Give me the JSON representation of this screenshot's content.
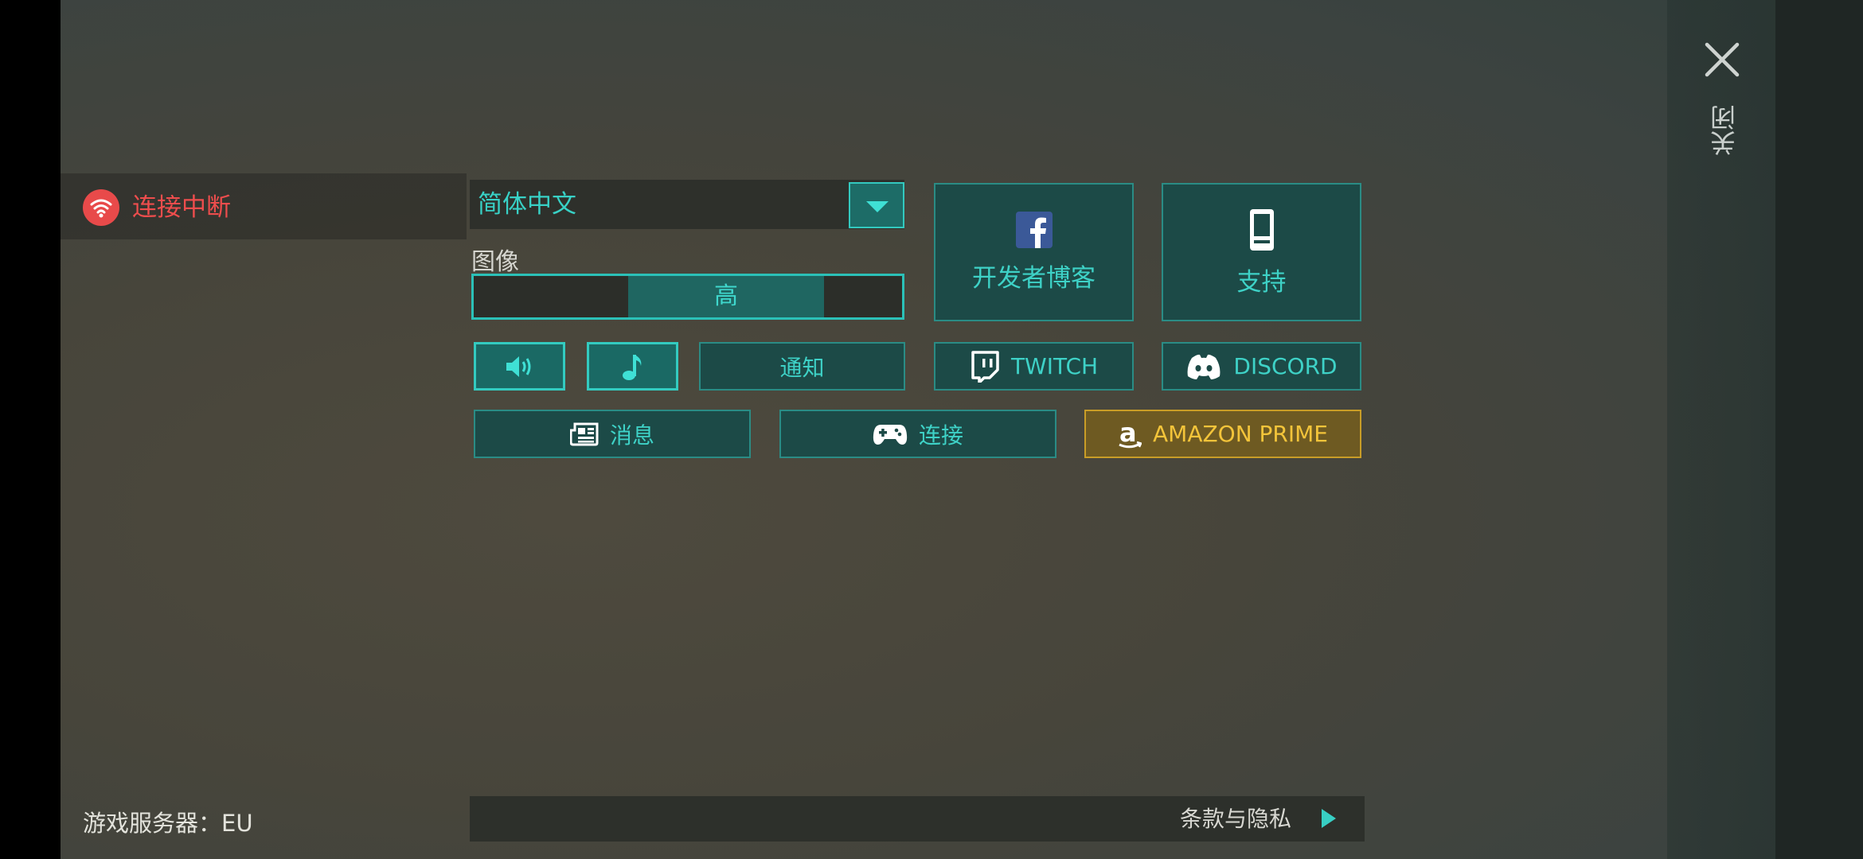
{
  "connection": {
    "status_label": "连接中断",
    "icon": "wifi-icon",
    "color": "#e84a4a"
  },
  "settings": {
    "language": {
      "selected": "简体中文",
      "icon": "chevron-down-icon"
    },
    "graphics": {
      "label": "图像",
      "selected": "高"
    },
    "notifications_label": "通知"
  },
  "links": {
    "blog": {
      "label": "开发者博客",
      "icon": "facebook-icon"
    },
    "support": {
      "label": "支持",
      "icon": "phone-icon"
    },
    "twitch": {
      "label": "TWITCH",
      "icon": "twitch-icon"
    },
    "discord": {
      "label": "DISCORD",
      "icon": "discord-icon"
    },
    "news": {
      "label": "消息",
      "icon": "newspaper-icon"
    },
    "connect": {
      "label": "连接",
      "icon": "gamepad-icon"
    },
    "amazon": {
      "label": "AMAZON PRIME",
      "icon": "amazon-icon"
    }
  },
  "toggles": {
    "sound_icon": "speaker-icon",
    "music_icon": "music-note-icon"
  },
  "close": {
    "label": "关闭",
    "icon": "close-icon"
  },
  "footer": {
    "server_label": "游戏服务器：",
    "server_value": "EU",
    "terms_label": "条款与隐私"
  },
  "colors": {
    "accent": "#38d1c6",
    "gold": "#f3c43a",
    "danger": "#ee4d4d"
  }
}
